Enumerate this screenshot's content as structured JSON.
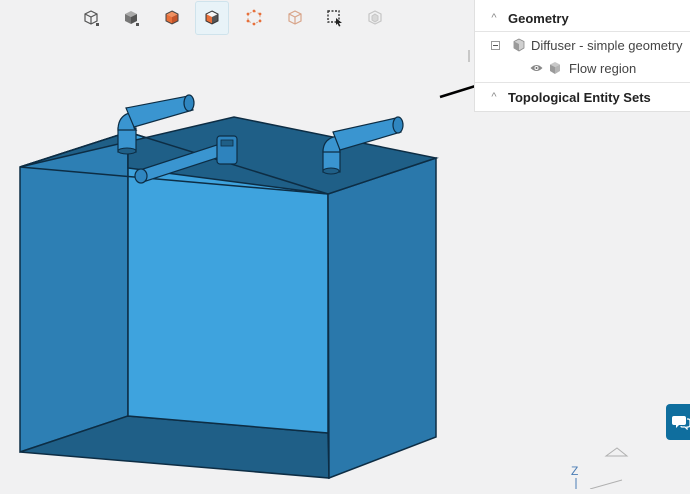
{
  "toolbar": {
    "buttons": [
      {
        "name": "view-wireframe-box-icon"
      },
      {
        "name": "view-shaded-box-icon"
      },
      {
        "name": "select-volume-icon"
      },
      {
        "name": "select-face-icon"
      },
      {
        "name": "select-edge-icon"
      },
      {
        "name": "select-vertex-icon"
      },
      {
        "name": "box-select-icon"
      },
      {
        "name": "hide-selection-icon"
      }
    ],
    "active_index": 3,
    "colors": {
      "orange": "#e8703a",
      "dark": "#555555",
      "light": "#c5c5c5"
    }
  },
  "tree": {
    "geometry_label": "Geometry",
    "diffuser_label": "Diffuser - simple geometry",
    "flow_region_label": "Flow region",
    "topological_label": "Topological Entity Sets"
  },
  "viewport": {
    "axis_label": "Z",
    "colors": {
      "front_face": "#3a9edc",
      "side_face": "#2a78ab",
      "top_face": "#1f5f87",
      "pipe": "#3a95d0",
      "outline": "#0d2d44",
      "background": "#f1f1f2"
    }
  },
  "chat": {
    "icon": "chat-bubble-icon",
    "color": "#0f6e9e"
  }
}
